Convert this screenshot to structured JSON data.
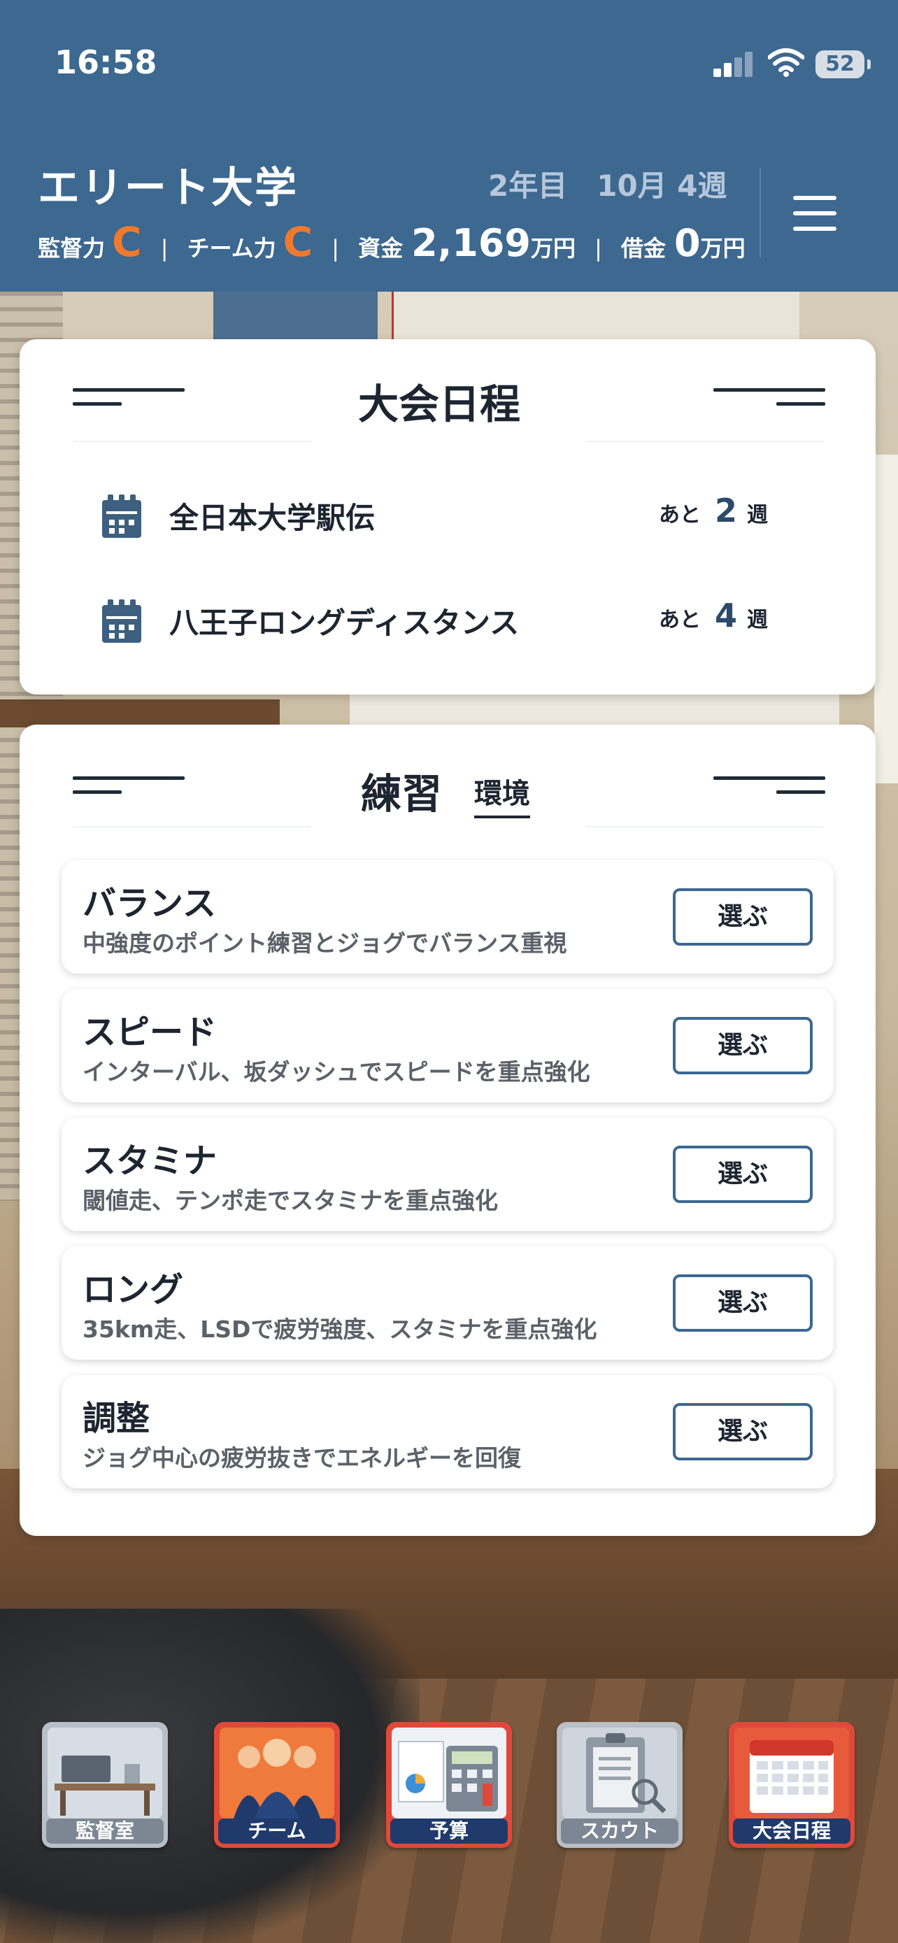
{
  "status_bar": {
    "time": "16:58",
    "battery": "52"
  },
  "header": {
    "university": "エリート大学",
    "date": "2年目　10月 4週",
    "coach_label": "監督力",
    "coach_grade": "C",
    "team_label": "チーム力",
    "team_grade": "C",
    "funds_label": "資金",
    "funds_value": "2,169",
    "funds_unit": "万円",
    "debt_label": "借金",
    "debt_value": "0",
    "debt_unit": "万円",
    "separator": "|"
  },
  "schedule": {
    "title": "大会日程",
    "remain_prefix": "あと",
    "remain_unit": "週",
    "events": [
      {
        "name": "全日本大学駅伝",
        "weeks": "2"
      },
      {
        "name": "八王子ロングディスタンス",
        "weeks": "4"
      }
    ]
  },
  "practice": {
    "title": "練習",
    "subtab": "環境",
    "select_label": "選ぶ",
    "options": [
      {
        "title": "バランス",
        "desc": "中強度のポイント練習とジョグでバランス重視"
      },
      {
        "title": "スピード",
        "desc": "インターバル、坂ダッシュでスピードを重点強化"
      },
      {
        "title": "スタミナ",
        "desc": "閾値走、テンポ走でスタミナを重点強化"
      },
      {
        "title": "ロング",
        "desc": "35km走、LSDで疲労強度、スタミナを重点強化"
      },
      {
        "title": "調整",
        "desc": "ジョグ中心の疲労抜きでエネルギーを回復"
      }
    ]
  },
  "nav": [
    {
      "label": "監督室",
      "icon": "desk-icon",
      "color": "#7d8794"
    },
    {
      "label": "チーム",
      "icon": "team-icon",
      "color": "#d2372b"
    },
    {
      "label": "予算",
      "icon": "calculator-icon",
      "color": "#d2372b"
    },
    {
      "label": "スカウト",
      "icon": "clipboard-icon",
      "color": "#7d8794"
    },
    {
      "label": "大会日程",
      "icon": "calendar-icon",
      "color": "#d2372b"
    }
  ],
  "colors": {
    "header": "#3d6890",
    "grade": "#f07a2c",
    "accent": "#3d6890"
  }
}
